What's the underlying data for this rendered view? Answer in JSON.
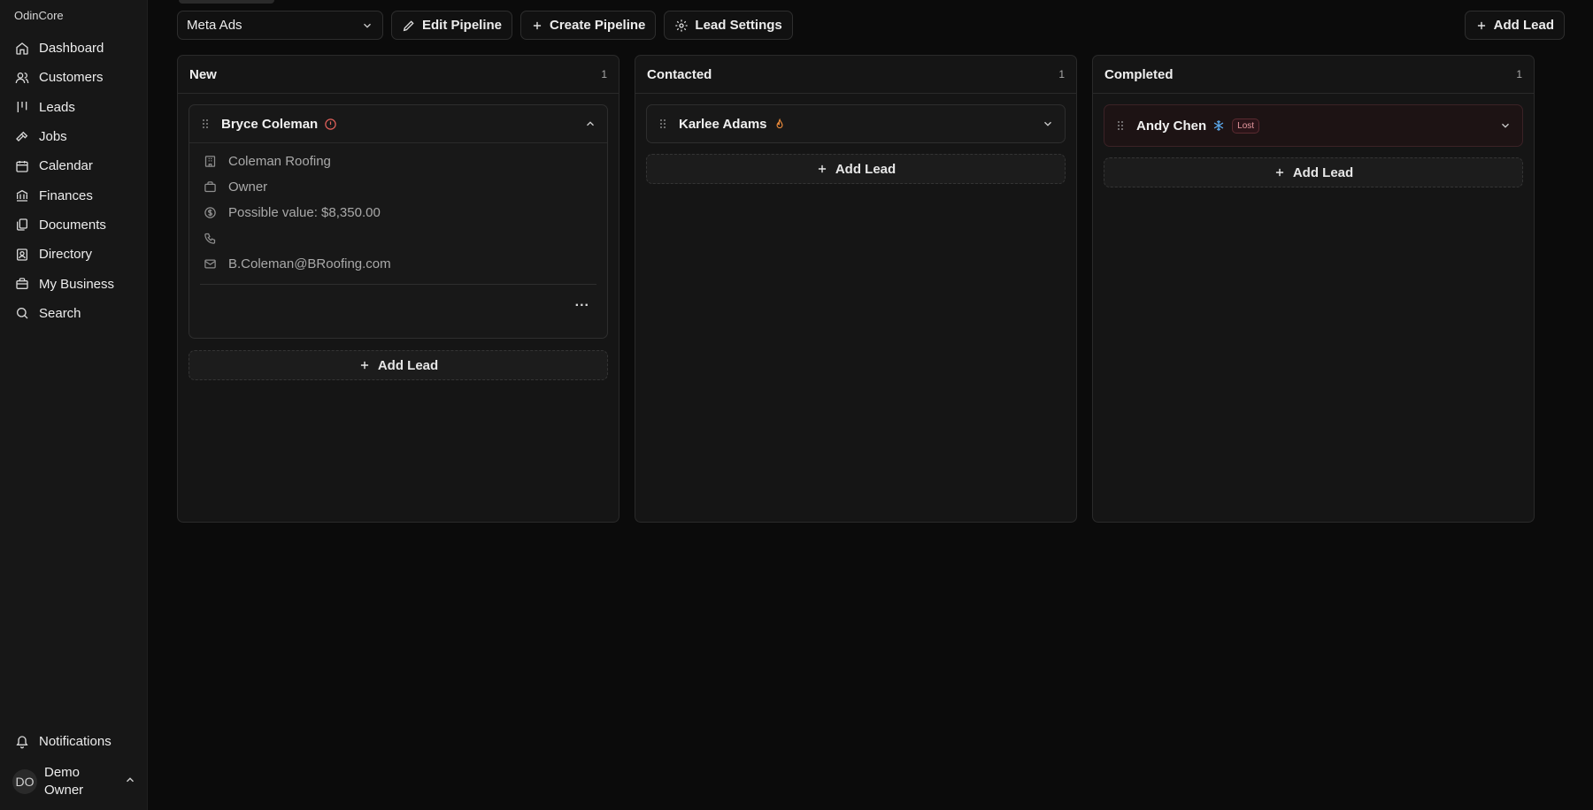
{
  "app": {
    "brand": "OdinCore"
  },
  "sidebar": {
    "items": [
      {
        "label": "Dashboard",
        "icon": "home-icon"
      },
      {
        "label": "Customers",
        "icon": "users-icon"
      },
      {
        "label": "Leads",
        "icon": "pipeline-icon"
      },
      {
        "label": "Jobs",
        "icon": "hammer-icon"
      },
      {
        "label": "Calendar",
        "icon": "calendar-icon"
      },
      {
        "label": "Finances",
        "icon": "bank-icon"
      },
      {
        "label": "Documents",
        "icon": "documents-icon"
      },
      {
        "label": "Directory",
        "icon": "contact-book-icon"
      },
      {
        "label": "My Business",
        "icon": "briefcase-icon"
      },
      {
        "label": "Search",
        "icon": "search-icon"
      }
    ],
    "notifications_label": "Notifications",
    "user": {
      "initials": "DO",
      "name": "Demo Owner"
    }
  },
  "toolbar": {
    "pipeline_select": "Meta Ads",
    "edit_pipeline": "Edit Pipeline",
    "create_pipeline": "Create Pipeline",
    "lead_settings": "Lead Settings",
    "add_lead": "Add Lead"
  },
  "columns": [
    {
      "title": "New",
      "count": "1",
      "cards": [
        {
          "name": "Bryce Coleman",
          "flag": "alert-icon",
          "expanded": true,
          "company": "Coleman Roofing",
          "role": "Owner",
          "value": "Possible value: $8,350.00",
          "phone": "",
          "email": "B.Coleman@BRoofing.com",
          "more": "..."
        }
      ],
      "add_label": "Add Lead"
    },
    {
      "title": "Contacted",
      "count": "1",
      "cards": [
        {
          "name": "Karlee Adams",
          "flag": "flame-icon",
          "expanded": false
        }
      ],
      "add_label": "Add Lead"
    },
    {
      "title": "Completed",
      "count": "1",
      "cards": [
        {
          "name": "Andy Chen",
          "flag": "snowflake-icon",
          "badge": "Lost",
          "expanded": false
        }
      ],
      "add_label": "Add Lead"
    }
  ],
  "colors": {
    "background": "#0b0b0b",
    "sidebar": "#171717",
    "column": "#151515",
    "alert": "#e0605a",
    "flame": "#e8893a",
    "snowflake": "#5aa6e8",
    "lost_badge": "#e79aa0"
  }
}
